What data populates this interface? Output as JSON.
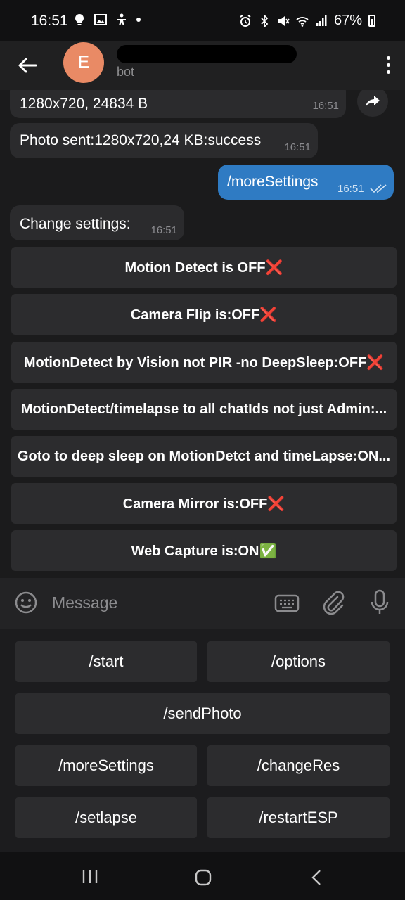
{
  "status_bar": {
    "time": "16:51",
    "battery": "67%"
  },
  "header": {
    "avatar_letter": "E",
    "subtitle": "bot"
  },
  "messages": [
    {
      "text": "1280x720, 24834 B",
      "time": "16:51",
      "direction": "in"
    },
    {
      "text": "Photo sent:1280x720,24 KB:success",
      "time": "16:51",
      "direction": "in"
    },
    {
      "text": "/moreSettings",
      "time": "16:51",
      "direction": "out"
    },
    {
      "text": "Change settings:",
      "time": "16:51",
      "direction": "in"
    }
  ],
  "inline_keyboard": [
    "Motion Detect is OFF❌",
    "Camera Flip is:OFF❌",
    "MotionDetect by Vision not PIR -no DeepSleep:OFF❌",
    "MotionDetect/timelapse to all chatIds not just Admin:...",
    "Goto to deep sleep on MotionDetct and timeLapse:ON...",
    "Camera Mirror is:OFF❌",
    "Web Capture is:ON✅"
  ],
  "input": {
    "placeholder": "Message"
  },
  "bot_keyboard": {
    "start": "/start",
    "options": "/options",
    "sendPhoto": "/sendPhoto",
    "moreSettings": "/moreSettings",
    "changeRes": "/changeRes",
    "setlapse": "/setlapse",
    "restartESP": "/restartESP"
  },
  "colors": {
    "background": "#1b1b1c",
    "bubble_in": "#2b2b2d",
    "bubble_out": "#2f7bc3",
    "avatar": "#e98a65"
  }
}
